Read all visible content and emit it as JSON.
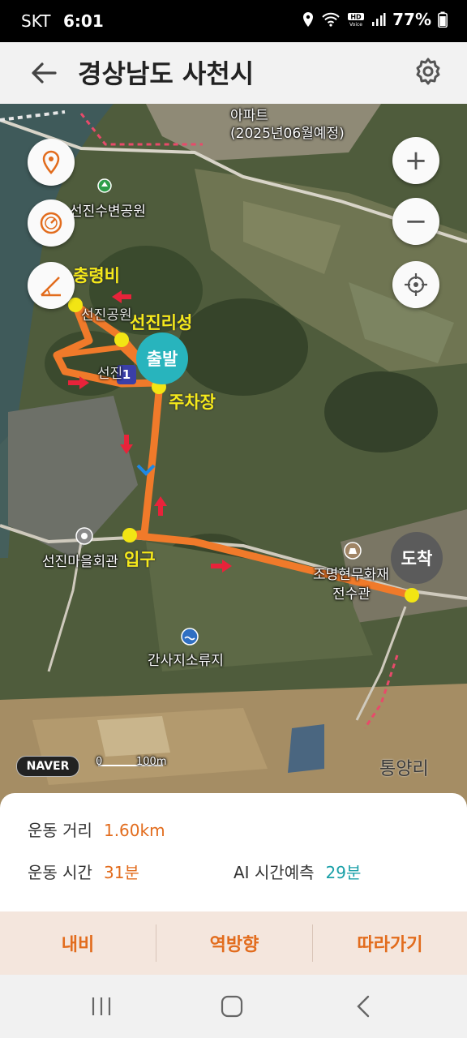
{
  "status": {
    "carrier": "SKT",
    "time": "6:01",
    "battery": "77%"
  },
  "header": {
    "title": "경상남도 사천시"
  },
  "map": {
    "place_labels": {
      "apt": "아파트",
      "apt_date": "(2025년06월예정)",
      "park": "선진수변공원",
      "hall": "선진마을회관",
      "pond": "간사지소류지",
      "treasure_1": "조명현무화재",
      "treasure_2": "전수관",
      "village": "통양리",
      "park_partial": "선진공원",
      "marker_num": "1",
      "fortress_partial": "선진"
    },
    "annotations": {
      "memorial": "충령비",
      "castle": "선진리성",
      "parking": "주차장",
      "entrance": "입구"
    },
    "markers": {
      "start": "출발",
      "end": "도착"
    },
    "brand": "NAVER",
    "scale": {
      "zero": "0",
      "distance": "100m"
    },
    "route_color": "#f07a2a"
  },
  "summary": {
    "distance_label": "운동 거리",
    "distance_value": "1.60km",
    "time_label": "운동 시간",
    "time_value": "31분",
    "ai_label": "AI 시간예측",
    "ai_value": "29분"
  },
  "actions": {
    "export": "내비",
    "reverse": "역방향",
    "follow": "따라가기"
  }
}
